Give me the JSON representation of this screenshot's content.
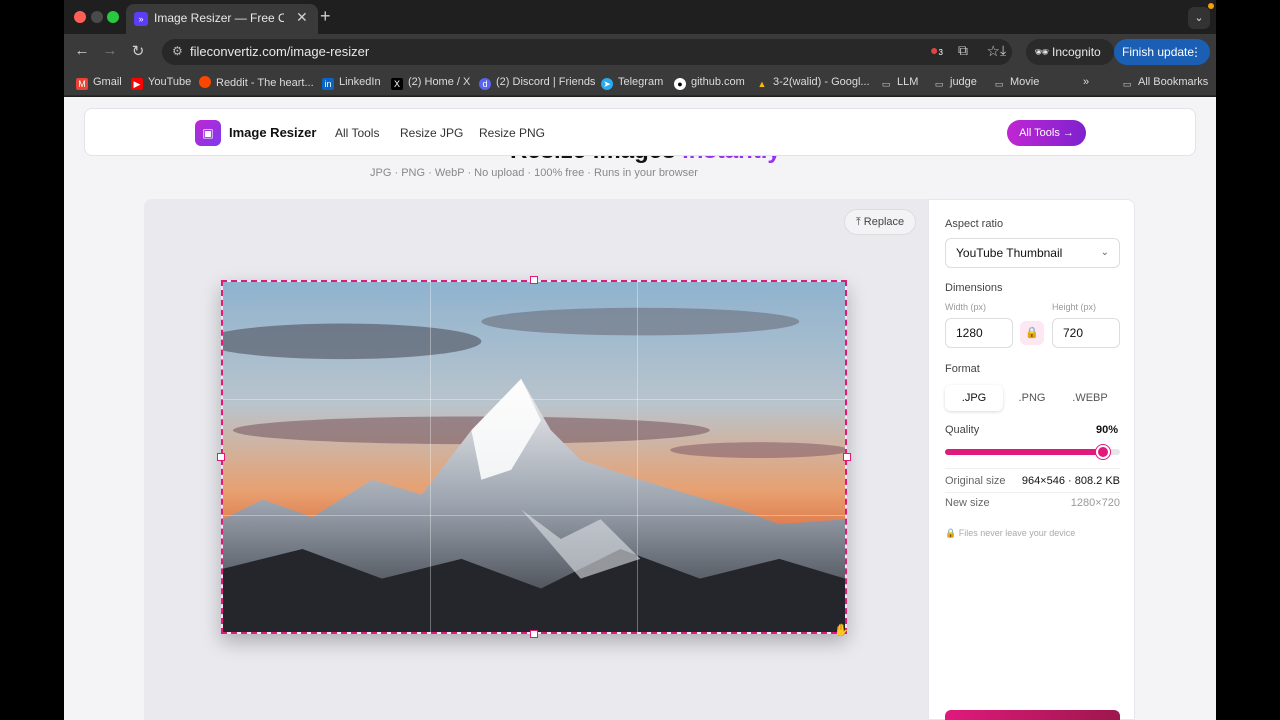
{
  "browser": {
    "tab_title": "Image Resizer — Free Online",
    "url": "fileconvertiz.com/image-resizer",
    "incognito_label": "Incognito",
    "finish_update_label": "Finish update",
    "extension_badge": "3",
    "bookmarks": [
      {
        "label": "Gmail",
        "icon": "gmail-icon",
        "color": "#ea4335",
        "glyph": "M"
      },
      {
        "label": "YouTube",
        "icon": "youtube-icon",
        "color": "#ff0000",
        "glyph": "▶"
      },
      {
        "label": "Reddit - The heart...",
        "icon": "reddit-icon",
        "color": "#ff4500",
        "glyph": "●"
      },
      {
        "label": "LinkedIn",
        "icon": "linkedin-icon",
        "color": "#0a66c2",
        "glyph": "in"
      },
      {
        "label": "(2) Home / X",
        "icon": "x-icon",
        "color": "#000000",
        "glyph": "X"
      },
      {
        "label": "(2) Discord | Friends",
        "icon": "discord-icon",
        "color": "#5865f2",
        "glyph": "d"
      },
      {
        "label": "Telegram",
        "icon": "telegram-icon",
        "color": "#2aabee",
        "glyph": "➤"
      },
      {
        "label": "github.com",
        "icon": "github-icon",
        "color": "#333333",
        "glyph": "●"
      },
      {
        "label": "3-2(walid) - Googl...",
        "icon": "drive-icon",
        "color": "#34a853",
        "glyph": "▲"
      },
      {
        "label": "LLM",
        "icon": "folder-icon",
        "color": "transparent",
        "glyph": "▭"
      },
      {
        "label": "judge",
        "icon": "folder-icon",
        "color": "transparent",
        "glyph": "▭"
      },
      {
        "label": "Movie",
        "icon": "folder-icon",
        "color": "transparent",
        "glyph": "▭"
      }
    ],
    "more_bookmarks": "»",
    "all_bookmarks": "All Bookmarks"
  },
  "header": {
    "brand": "Image Resizer",
    "nav": [
      "All Tools",
      "Resize JPG",
      "Resize PNG"
    ],
    "cta": "All Tools →"
  },
  "hero": {
    "heading_a": "Resize images ",
    "heading_b": "instantly",
    "subline": "JPG · PNG · WebP · No upload · 100% free · Runs in your browser"
  },
  "editor": {
    "replace_label": "Replace"
  },
  "panel": {
    "aspect_label": "Aspect ratio",
    "aspect_value": "YouTube Thumbnail",
    "dimensions_label": "Dimensions",
    "width_label": "Width (px)",
    "height_label": "Height (px)",
    "width_value": "1280",
    "height_value": "720",
    "format_label": "Format",
    "formats": [
      ".JPG",
      ".PNG",
      ".WEBP"
    ],
    "active_format": ".JPG",
    "quality_label": "Quality",
    "quality_value": "90%",
    "quality_fraction": 0.9,
    "original_size_label": "Original size",
    "original_size_value": "964×546 · 808.2 KB",
    "new_size_label": "New size",
    "new_size_value": "1280×720",
    "privacy_note": "Files never leave your device"
  },
  "colors": {
    "accent": "#e0197c",
    "brand_purple": "#7c3aed",
    "chrome_blue": "#1a5fb4"
  }
}
